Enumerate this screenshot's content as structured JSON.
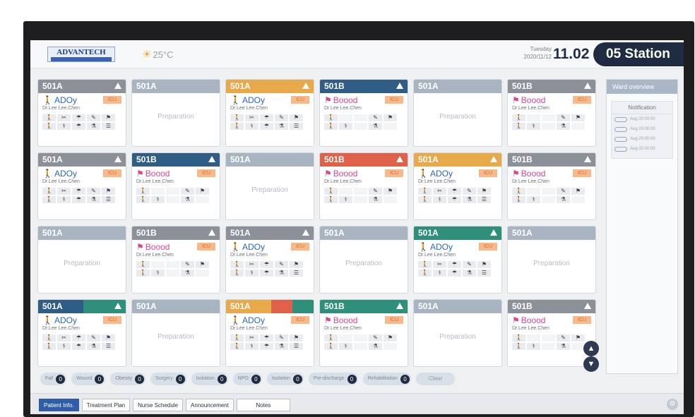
{
  "header": {
    "logo": "ADVANTECH",
    "weather": "25°C",
    "day": "Tuesday",
    "date": "2020/11/12",
    "time": "11.02",
    "station": "05 Station"
  },
  "colors": {
    "gray": "#8c9099",
    "lightgray": "#a8b4c2",
    "orange": "#e7a94a",
    "blue": "#2f5d86",
    "red": "#e0614a",
    "green": "#2e8f7a",
    "navy": "#1f2b40",
    "patient_blue": "#2b64c8",
    "patient_pink": "#d9468f"
  },
  "cards": [
    {
      "room": "501A",
      "color": "gray",
      "state": "patient",
      "warn": true,
      "kind": "ADOy"
    },
    {
      "room": "501A",
      "color": "lightgray",
      "state": "prep"
    },
    {
      "room": "501A",
      "color": "orange",
      "state": "patient",
      "warn": true,
      "kind": "ADOy"
    },
    {
      "room": "501B",
      "color": "blue",
      "state": "patient",
      "warn": true,
      "kind": "Boood"
    },
    {
      "room": "501A",
      "color": "lightgray",
      "state": "prep"
    },
    {
      "room": "501B",
      "color": "gray",
      "state": "patient",
      "warn": true,
      "kind": "Boood"
    },
    {
      "room": "501A",
      "color": "gray",
      "state": "patient",
      "warn": true,
      "kind": "ADOy"
    },
    {
      "room": "501B",
      "color": "blue",
      "state": "patient",
      "warn": true,
      "kind": "Boood"
    },
    {
      "room": "501A",
      "color": "lightgray",
      "state": "prep"
    },
    {
      "room": "501B",
      "color": "red",
      "state": "patient",
      "warn": true,
      "kind": "Boood"
    },
    {
      "room": "501A",
      "color": "orange",
      "state": "patient",
      "warn": true,
      "kind": "ADOy"
    },
    {
      "room": "501B",
      "color": "gray",
      "state": "patient",
      "warn": true,
      "kind": "Boood"
    },
    {
      "room": "501A",
      "color": "lightgray",
      "state": "prep"
    },
    {
      "room": "501B",
      "color": "gray",
      "state": "patient",
      "warn": true,
      "kind": "Boood"
    },
    {
      "room": "501A",
      "color": "gray",
      "state": "patient",
      "warn": true,
      "kind": "ADOy"
    },
    {
      "room": "501A",
      "color": "lightgray",
      "state": "prep"
    },
    {
      "room": "501A",
      "color": "green",
      "state": "patient",
      "warn": true,
      "kind": "ADOy"
    },
    {
      "room": "501A",
      "color": "lightgray",
      "state": "prep"
    },
    {
      "room": "501A",
      "color": "blue",
      "state": "patient",
      "warn": true,
      "kind": "ADOy",
      "split": "green"
    },
    {
      "room": "501A",
      "color": "lightgray",
      "state": "prep"
    },
    {
      "room": "501A",
      "color": "orange",
      "state": "patient",
      "warn": false,
      "kind": "ADOy",
      "split": "redgreen"
    },
    {
      "room": "501B",
      "color": "green",
      "state": "patient",
      "warn": true,
      "kind": "Boood"
    },
    {
      "room": "501A",
      "color": "lightgray",
      "state": "prep"
    },
    {
      "room": "501B",
      "color": "gray",
      "state": "patient",
      "warn": true,
      "kind": "Boood"
    }
  ],
  "card_text": {
    "prep": "Preparation",
    "diagnosis": "Dr.Lee  Lee.Chen",
    "tag": "ICU"
  },
  "right_panel": {
    "title": "Ward overview",
    "notif_title": "Notification",
    "items": [
      "Aug  20:00:00",
      "Aug  20:00:00",
      "Aug  20:00:00",
      "Aug  20:00:00"
    ]
  },
  "filters": [
    {
      "label": "Fall",
      "count": "0"
    },
    {
      "label": "Wound",
      "count": "0"
    },
    {
      "label": "Obesity",
      "count": "0"
    },
    {
      "label": "Surgery",
      "count": "0"
    },
    {
      "label": "Isolation",
      "count": "0"
    },
    {
      "label": "NPO",
      "count": "0"
    },
    {
      "label": "Isolation",
      "count": "0"
    },
    {
      "label": "Pre-discharge",
      "count": "0"
    },
    {
      "label": "Rehabilitation",
      "count": "0"
    }
  ],
  "clear_label": "Clear",
  "tabs": [
    "Patient Info.",
    "Treatment Plan",
    "Nurse Schedule",
    "Announcement",
    "Notes"
  ]
}
